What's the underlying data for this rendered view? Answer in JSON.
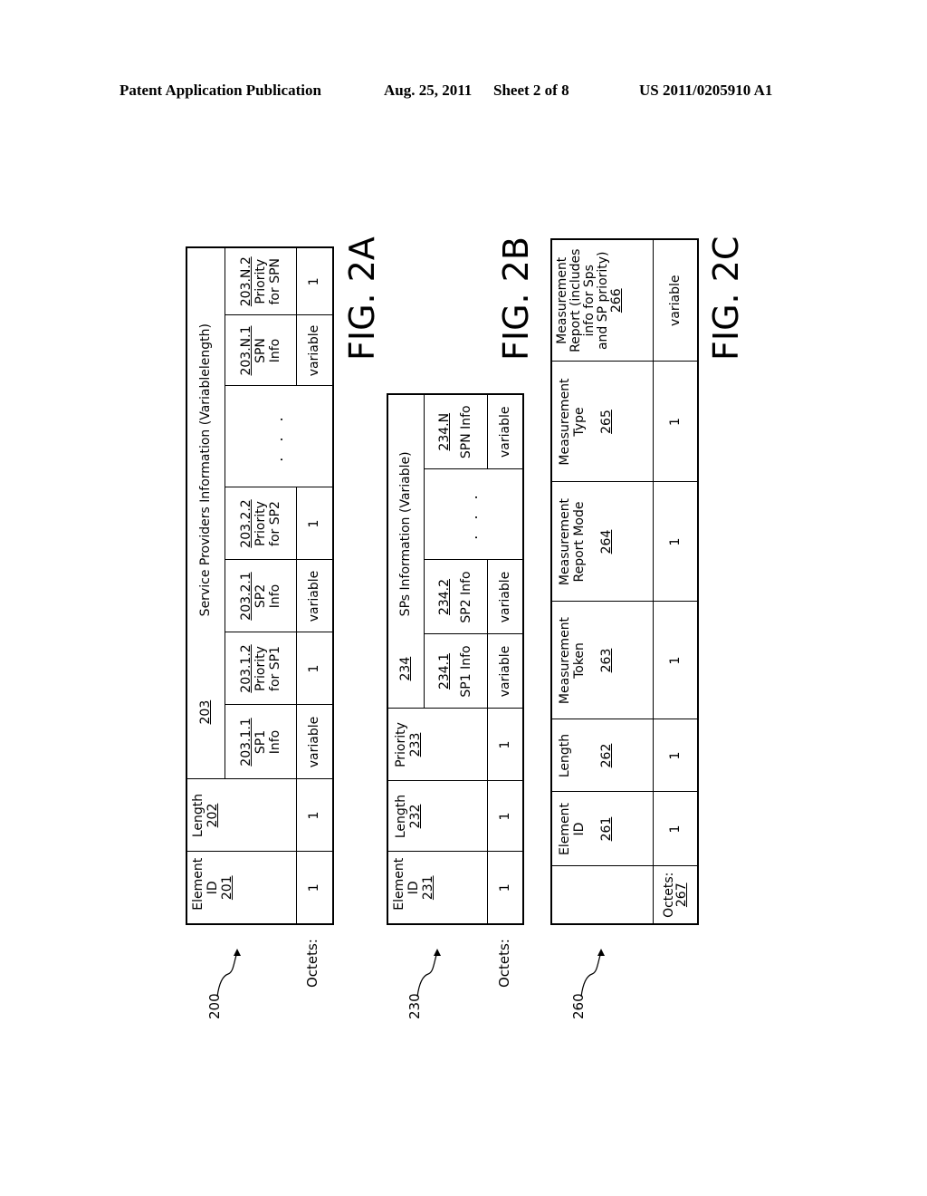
{
  "header": {
    "left": "Patent Application Publication",
    "date": "Aug. 25, 2011",
    "sheet": "Sheet 2 of 8",
    "number": "US 2011/0205910 A1"
  },
  "fig2a": {
    "label": "FIG. 2A",
    "ref": "200",
    "octets_label": "Octets:",
    "group_ref": "203",
    "group_title": "Service Providers Information (Variablelength)",
    "fields": [
      {
        "name": "Element ID",
        "ref": "201",
        "octets": "1"
      },
      {
        "name": "Length",
        "ref": "202",
        "octets": "1"
      }
    ],
    "subfields": [
      {
        "ref": "203.1.1",
        "name_l1": "SP1",
        "name_l2": "Info",
        "octets": "variable"
      },
      {
        "ref": "203.1.2",
        "name_l1": "Priority",
        "name_l2": "for SP1",
        "octets": "1"
      },
      {
        "ref": "203.2.1",
        "name_l1": "SP2",
        "name_l2": "Info",
        "octets": "variable"
      },
      {
        "ref": "203.2.2",
        "name_l1": "Priority",
        "name_l2": "for SP2",
        "octets": "1"
      },
      {
        "ellipsis": ". . .",
        "octets": ""
      },
      {
        "ref": "203.N.1",
        "name_l1": "SPN",
        "name_l2": "Info",
        "octets": "variable"
      },
      {
        "ref": "203.N.2",
        "name_l1": "Priority",
        "name_l2": "for SPN",
        "octets": "1"
      }
    ]
  },
  "fig2b": {
    "label": "FIG. 2B",
    "ref": "230",
    "octets_label": "Octets:",
    "group_ref": "234",
    "group_title": "SPs Information (Variable)",
    "fields": [
      {
        "name": "Element ID",
        "ref": "231",
        "octets": "1"
      },
      {
        "name": "Length",
        "ref": "232",
        "octets": "1"
      },
      {
        "name": "Priority",
        "ref": "233",
        "octets": "1"
      }
    ],
    "subfields": [
      {
        "ref": "234.1",
        "name": "SP1 Info",
        "octets": "variable"
      },
      {
        "ref": "234.2",
        "name": "SP2 Info",
        "octets": "variable"
      },
      {
        "ellipsis": ". . .",
        "octets": ""
      },
      {
        "ref": "234.N",
        "name": "SPN Info",
        "octets": "variable"
      }
    ]
  },
  "fig2c": {
    "label": "FIG. 2C",
    "ref": "260",
    "octets_label": "Octets:",
    "octets_ref": "267",
    "fields": [
      {
        "name_l1": "Element",
        "name_l2": "ID",
        "ref": "261",
        "octets": "1"
      },
      {
        "name_l1": "Length",
        "name_l2": "",
        "ref": "262",
        "octets": "1"
      },
      {
        "name_l1": "Measurement",
        "name_l2": "Token",
        "ref": "263",
        "octets": "1"
      },
      {
        "name_l1": "Measurement",
        "name_l2": "Report Mode",
        "ref": "264",
        "octets": "1"
      },
      {
        "name_l1": "Measurement",
        "name_l2": "Type",
        "ref": "265",
        "octets": "1"
      }
    ],
    "report": {
      "l1": "Measurement",
      "l2": "Report (includes",
      "l3": "info for Sps",
      "l4": "and SP priority)",
      "ref": "266",
      "octets": "variable"
    }
  }
}
